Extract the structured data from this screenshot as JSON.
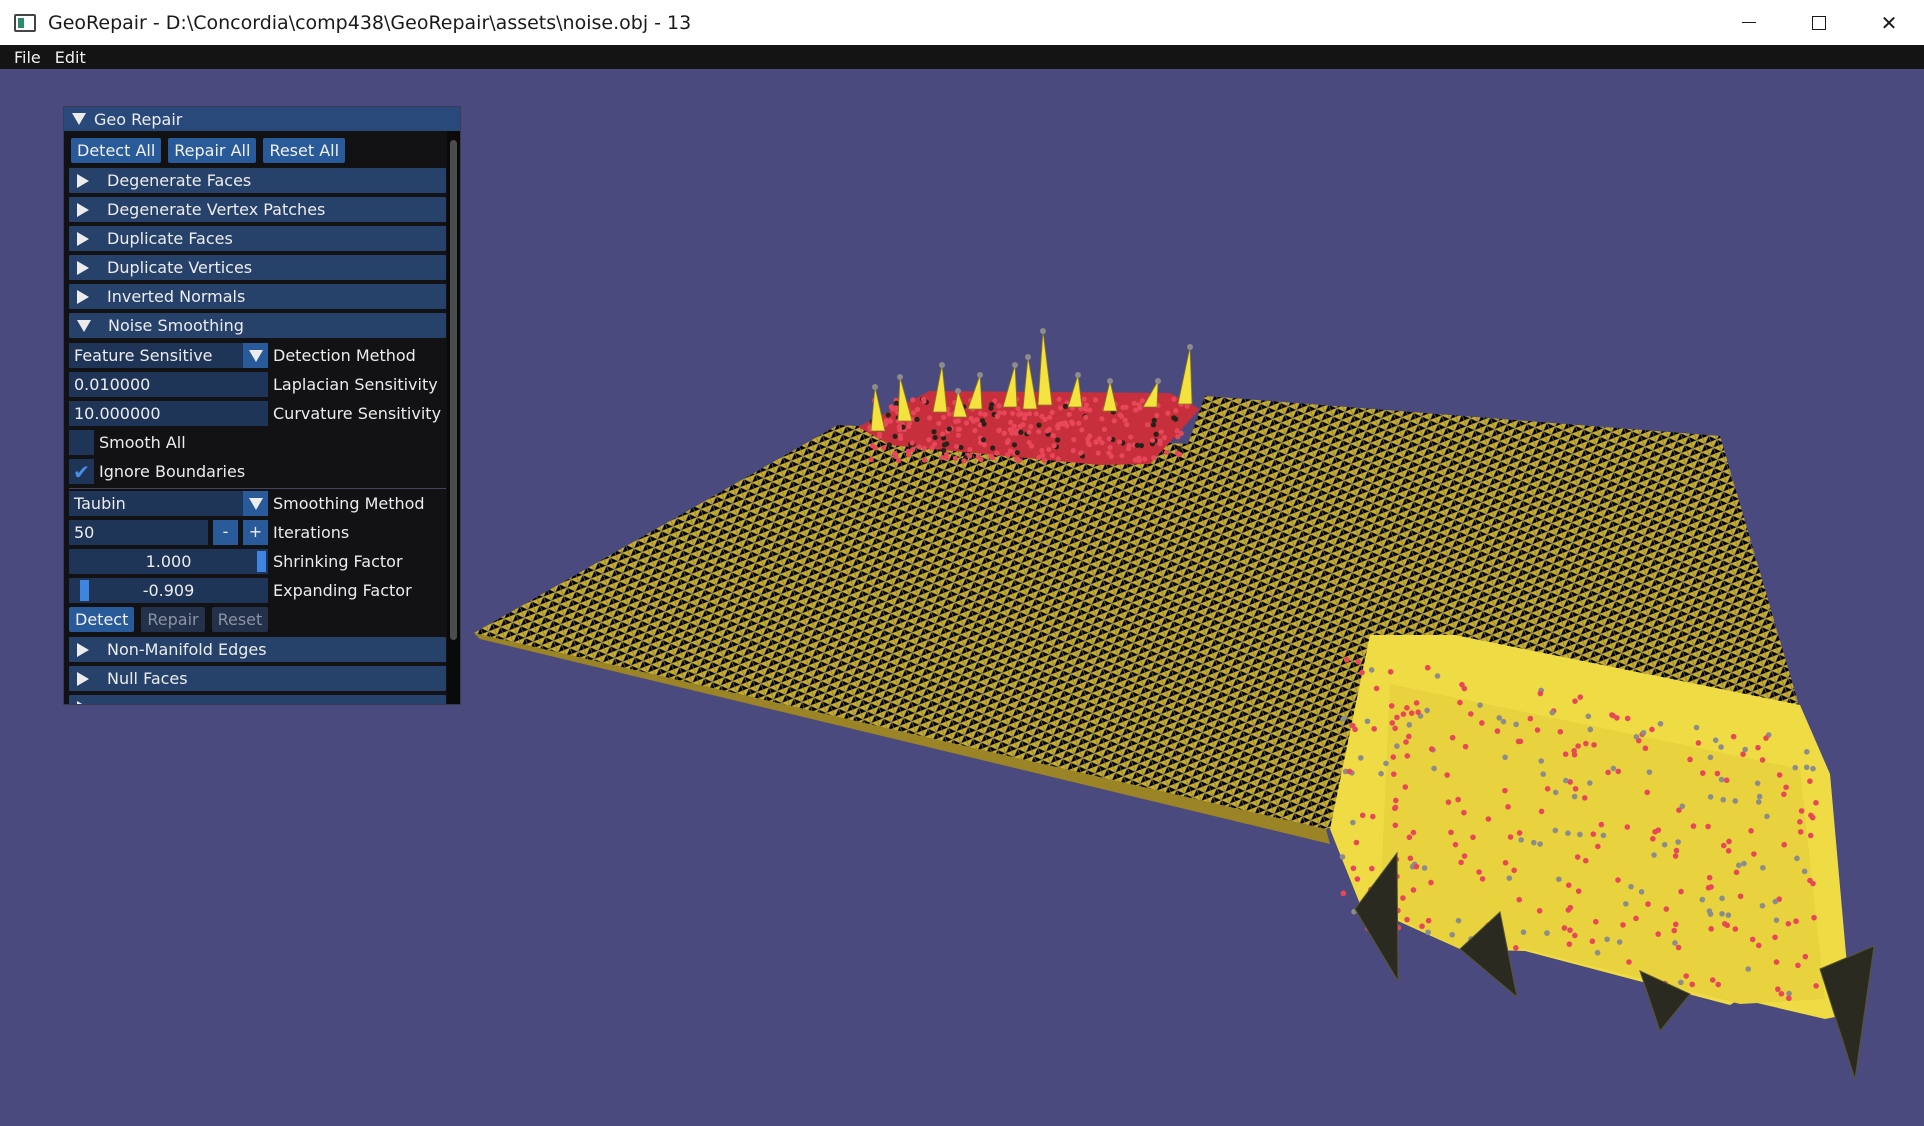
{
  "window": {
    "title": "GeoRepair - D:\\Concordia\\comp438\\GeoRepair\\assets\\noise.obj - 13",
    "controls": {
      "minimize": "—",
      "close": "✕"
    }
  },
  "menu": {
    "items": [
      "File",
      "Edit"
    ]
  },
  "panel": {
    "title": "Geo Repair",
    "top_buttons": [
      "Detect All",
      "Repair All",
      "Reset All"
    ],
    "sections_before": [
      "Degenerate Faces",
      "Degenerate Vertex Patches",
      "Duplicate Faces",
      "Duplicate Vertices",
      "Inverted Normals"
    ],
    "open_section": "Noise Smoothing",
    "detection_method": {
      "value": "Feature Sensitive",
      "label": "Detection Method"
    },
    "laplacian": {
      "value": "0.010000",
      "label": "Laplacian Sensitivity"
    },
    "curvature": {
      "value": "10.000000",
      "label": "Curvature Sensitivity"
    },
    "smooth_all": {
      "label": "Smooth All",
      "checked": false
    },
    "ignore_boundaries": {
      "label": "Ignore Boundaries",
      "checked": true,
      "check_glyph": "✔"
    },
    "smoothing_method": {
      "value": "Taubin",
      "label": "Smoothing Method"
    },
    "iterations": {
      "value": "50",
      "label": "Iterations",
      "minus": "-",
      "plus": "+"
    },
    "shrinking": {
      "value": "1.000",
      "label": "Shrinking Factor",
      "fraction": 1.0
    },
    "expanding": {
      "value": "-0.909",
      "label": "Expanding Factor",
      "fraction": 0.05
    },
    "section_buttons": [
      "Detect",
      "Repair",
      "Reset"
    ],
    "sections_after": [
      "Non-Manifold Edges",
      "Null Faces"
    ]
  },
  "colors": {
    "background": "#4b4a7e",
    "mesh_face": "#cbb02a",
    "vertex": "#8a8a8a",
    "flagged_vertex": "#e8475a",
    "accent": "#295a99"
  }
}
